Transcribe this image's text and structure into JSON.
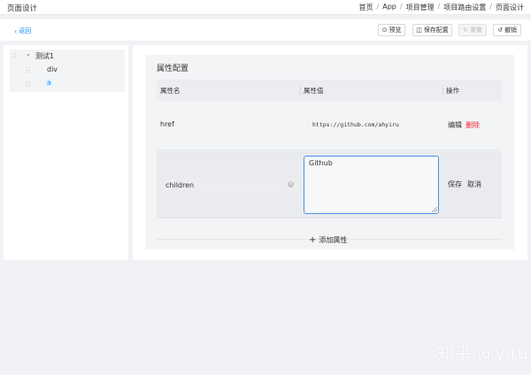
{
  "header": {
    "title": "页面设计",
    "breadcrumb": [
      "首页",
      "App",
      "项目管理",
      "项目路由设置",
      "页面设计"
    ]
  },
  "toolbar": {
    "back_label": "返回",
    "preview_label": "预览",
    "save_config_label": "保存配置",
    "redo_label": "重做",
    "undo_label": "撤销"
  },
  "tree": {
    "items": [
      {
        "label": "测试1",
        "expanded": true
      },
      {
        "label": "div"
      },
      {
        "label": "a",
        "selected": true
      }
    ]
  },
  "panel": {
    "title": "属性配置",
    "columns": [
      "属性名",
      "属性值",
      "操作"
    ],
    "add_label": "添加属性"
  },
  "rows": [
    {
      "name": "href",
      "value": "https://github.com/ahyiru",
      "actions": [
        "编辑",
        "删除"
      ]
    },
    {
      "name_input": "children",
      "value_input": "Github",
      "actions": [
        "保存",
        "取消"
      ]
    }
  ],
  "colors": {
    "accent": "#1890ff",
    "danger": "#f5222d",
    "focus_border": "#4a90e2"
  },
  "watermark": "知乎 @yiru"
}
